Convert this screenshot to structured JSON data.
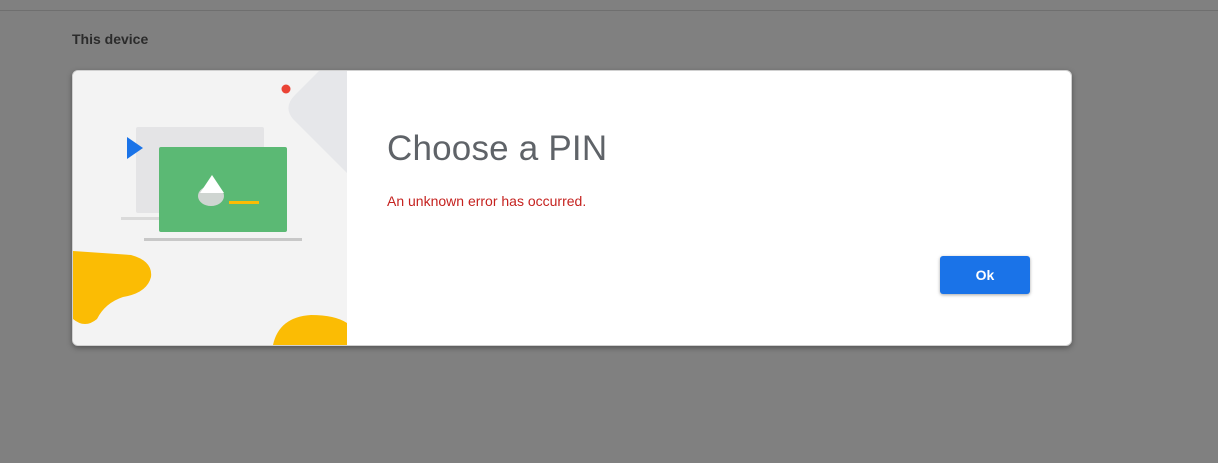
{
  "page": {
    "section_label": "This device"
  },
  "dialog": {
    "title": "Choose a PIN",
    "error_message": "An unknown error has occurred.",
    "ok_label": "Ok",
    "illustration_icon": "laptop-with-pin-icon"
  },
  "colors": {
    "overlay": "#808080",
    "accent_blue": "#1a73e8",
    "error_red": "#c5221f",
    "illustration_green": "#5bb974",
    "illustration_yellow": "#fbbc04",
    "illustration_red_dot": "#ea4335"
  }
}
